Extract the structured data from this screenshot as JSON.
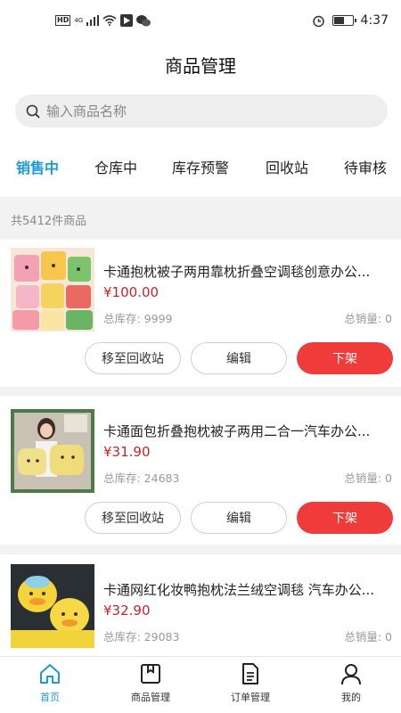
{
  "status_bar": {
    "hd": "HD",
    "net": "4G",
    "time": "4:37",
    "battery_level": 0.6
  },
  "header": {
    "title": "商品管理"
  },
  "search": {
    "placeholder": "输入商品名称"
  },
  "tabs": [
    {
      "label": "销售中",
      "active": true
    },
    {
      "label": "仓库中"
    },
    {
      "label": "库存预警"
    },
    {
      "label": "回收站"
    },
    {
      "label": "待审核"
    }
  ],
  "count_text": "共5412件商品",
  "products": [
    {
      "title": "卡通抱枕被子两用靠枕折叠空调毯创意办公...",
      "price": "¥100.00",
      "stock": "总库存: 9999",
      "sales": "总销量: 0",
      "btn_recycle": "移至回收站",
      "btn_edit": "编辑",
      "btn_off": "下架"
    },
    {
      "title": "卡通面包折叠抱枕被子两用二合一汽车办公...",
      "price": "¥31.90",
      "stock": "总库存: 24683",
      "sales": "总销量: 0",
      "btn_recycle": "移至回收站",
      "btn_edit": "编辑",
      "btn_off": "下架"
    },
    {
      "title": "卡通网红化妆鸭抱枕法兰绒空调毯 汽车办公...",
      "price": "¥32.90",
      "stock": "总库存: 29083",
      "sales": "总销量: 0"
    }
  ],
  "bottom_nav": [
    {
      "label": "首页",
      "icon": "home-icon",
      "active": true
    },
    {
      "label": "商品管理",
      "icon": "box-icon"
    },
    {
      "label": "订单管理",
      "icon": "document-icon"
    },
    {
      "label": "我的",
      "icon": "user-icon"
    }
  ],
  "colors": {
    "accent": "#1e9ad6",
    "danger": "#f03b3b",
    "price": "#c8232c"
  }
}
